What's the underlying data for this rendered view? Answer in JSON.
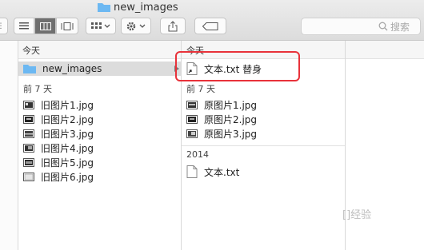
{
  "window": {
    "title": "new_images"
  },
  "search": {
    "label": "搜索"
  },
  "column1": {
    "header": "今天",
    "today_items": [
      {
        "name": "new_images",
        "icon": "folder-icon"
      }
    ],
    "section_label": "前 7 天",
    "week_items": [
      {
        "name": "旧图片1.jpg"
      },
      {
        "name": "旧图片2.jpg"
      },
      {
        "name": "旧图片3.jpg"
      },
      {
        "name": "旧图片4.jpg"
      },
      {
        "name": "旧图片5.jpg"
      },
      {
        "name": "旧图片6.jpg"
      }
    ]
  },
  "column2": {
    "header": "今天",
    "today_items": [
      {
        "name": "文本.txt 替身",
        "icon": "alias-document-icon"
      }
    ],
    "section_label": "前 7 天",
    "week_items": [
      {
        "name": "原图片1.jpg"
      },
      {
        "name": "原图片2.jpg"
      },
      {
        "name": "原图片3.jpg"
      }
    ],
    "year_label": "2014",
    "year_items": [
      {
        "name": "文本.txt",
        "icon": "document-icon"
      }
    ]
  },
  "watermark": {
    "text": "[]经验"
  }
}
